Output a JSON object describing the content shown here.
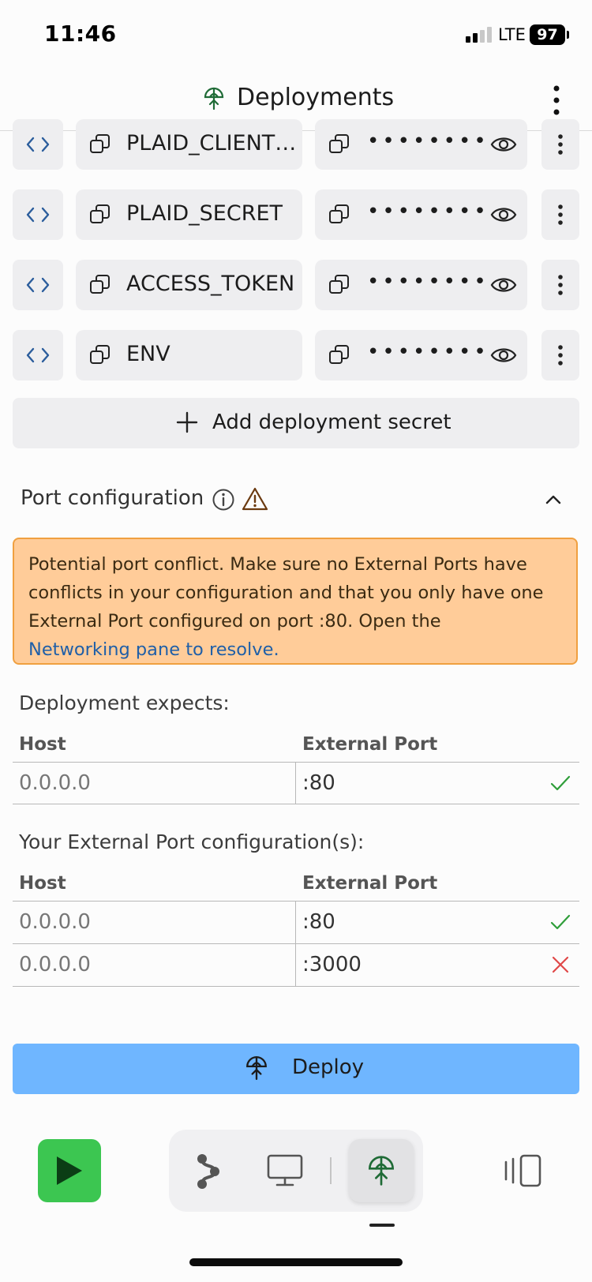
{
  "status_bar": {
    "time": "11:46",
    "network": "LTE",
    "battery": "97"
  },
  "header": {
    "title": "Deployments",
    "icon": "deployments-icon",
    "menu_icon": "more-vertical-icon"
  },
  "secrets": [
    {
      "key": "PLAID_CLIENT…",
      "value_masked": "••••••••"
    },
    {
      "key": "PLAID_SECRET",
      "value_masked": "••••••••"
    },
    {
      "key": "ACCESS_TOKEN",
      "value_masked": "••••••••"
    },
    {
      "key": "ENV",
      "value_masked": "••••••••"
    }
  ],
  "add_secret_label": "Add deployment secret",
  "port_config": {
    "title": "Port configuration",
    "expanded": true,
    "alert": {
      "message": "Potential port conflict. Make sure no External Ports have conflicts in your configuration and that you only have one External Port configured on port :80. Open the",
      "link": "Networking pane to resolve."
    },
    "expects": {
      "label": "Deployment expects:",
      "headers": {
        "host": "Host",
        "port": "External Port"
      },
      "rows": [
        {
          "host": "0.0.0.0",
          "port": ":80",
          "status": "ok"
        }
      ]
    },
    "yours": {
      "label": "Your External Port configuration(s):",
      "headers": {
        "host": "Host",
        "port": "External Port"
      },
      "rows": [
        {
          "host": "0.0.0.0",
          "port": ":80",
          "status": "ok"
        },
        {
          "host": "0.0.0.0",
          "port": ":3000",
          "status": "error"
        }
      ]
    }
  },
  "deploy_button": {
    "label": "Deploy"
  },
  "colors": {
    "alert_bg": "#ffcc99",
    "alert_border": "#f0a040",
    "link": "#1f5fa8",
    "deploy_bg": "#6fb6ff",
    "run_bg": "#3cc651",
    "ok": "#2f9e3a",
    "error": "#e04848"
  },
  "dock": {
    "items": [
      "git-icon",
      "webview-icon",
      "deployments-icon"
    ],
    "active": "deployments-icon"
  }
}
